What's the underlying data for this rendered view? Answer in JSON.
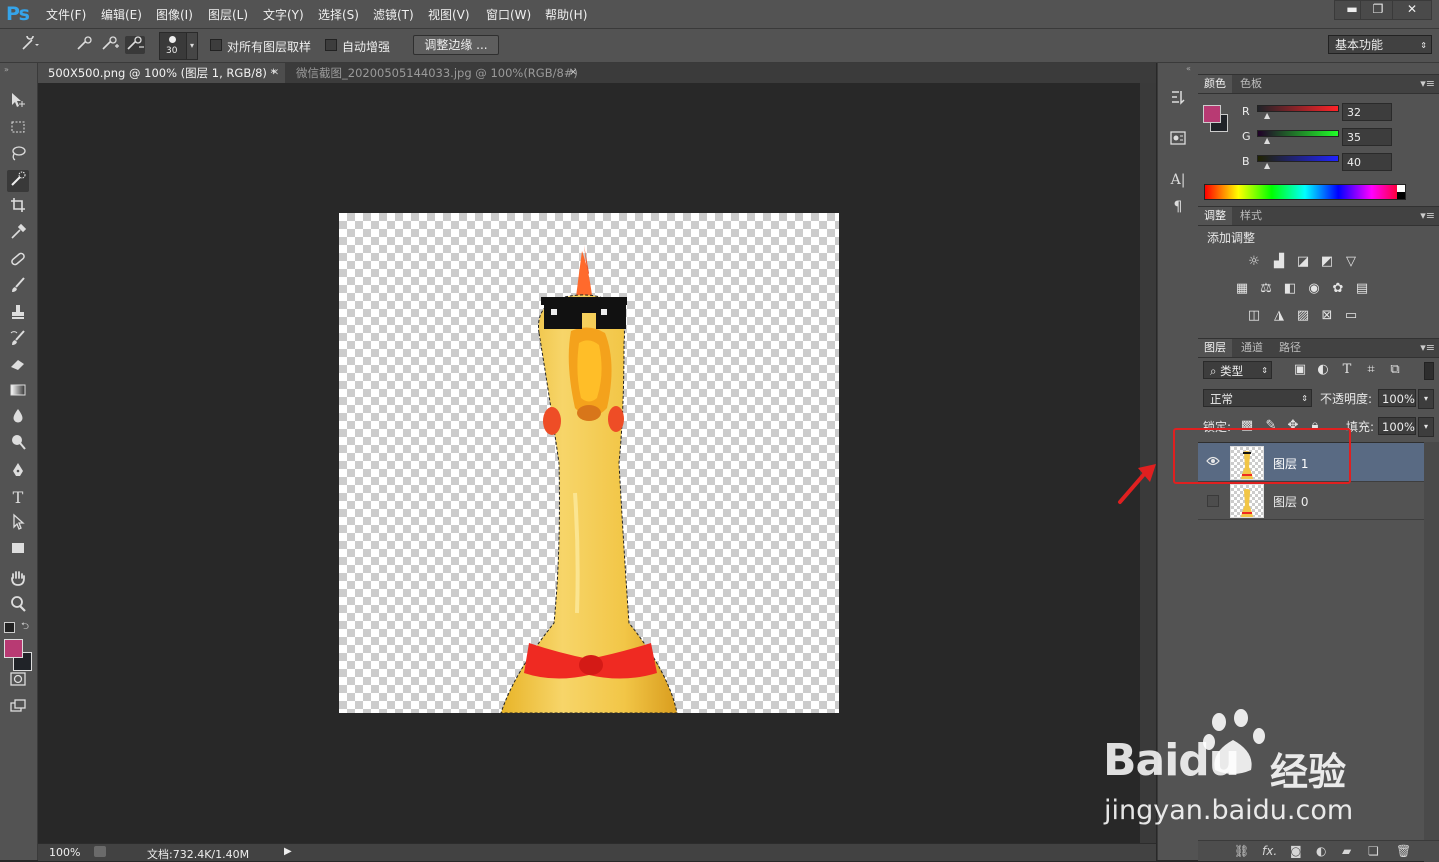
{
  "app": {
    "logo": "Ps"
  },
  "menu": [
    "文件(F)",
    "编辑(E)",
    "图像(I)",
    "图层(L)",
    "文字(Y)",
    "选择(S)",
    "滤镜(T)",
    "视图(V)",
    "窗口(W)",
    "帮助(H)"
  ],
  "window_controls": {
    "minimize": "▬",
    "restore": "❐",
    "close": "✕"
  },
  "options": {
    "brush_size": "30",
    "sample_all_layers": "对所有图层取样",
    "auto_enhance": "自动增强",
    "refine_edge": "调整边缘 ...",
    "workspace": "基本功能"
  },
  "tabs": [
    {
      "label": "500X500.png @ 100% (图层 1, RGB/8) *",
      "close": "✕"
    },
    {
      "label": "微信截图_20200505144033.jpg @ 100%(RGB/8#)",
      "close": "✕"
    }
  ],
  "status": {
    "zoom": "100%",
    "doc_info": "文档:732.4K/1.40M"
  },
  "color_panel": {
    "tabs": [
      "颜色",
      "色板"
    ],
    "channels": [
      {
        "label": "R",
        "value": "32"
      },
      {
        "label": "G",
        "value": "35"
      },
      {
        "label": "B",
        "value": "40"
      }
    ],
    "foreground": "#b83a73",
    "background": "#202328"
  },
  "adjust_panel": {
    "tabs": [
      "调整",
      "样式"
    ],
    "title": "添加调整"
  },
  "layers_panel": {
    "tabs": [
      "图层",
      "通道",
      "路径"
    ],
    "filter": "类型",
    "blend_mode": "正常",
    "opacity_label": "不透明度:",
    "opacity_value": "100%",
    "lock_label": "锁定:",
    "fill_label": "填充:",
    "fill_value": "100%",
    "layers": [
      {
        "name": "图层 1",
        "visible": true,
        "selected": true
      },
      {
        "name": "图层 0",
        "visible": false,
        "selected": false
      }
    ]
  },
  "watermark": {
    "brand": "Baidu",
    "text": "经验",
    "url": "jingyan.baidu.com"
  },
  "annotation": {
    "highlight_color": "#e02020"
  }
}
